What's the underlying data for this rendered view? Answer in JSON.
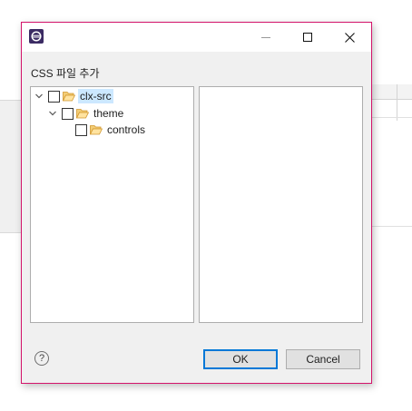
{
  "dialog": {
    "title": "CSS 파일 추가",
    "window_controls": {
      "minimize": "minimize-icon",
      "maximize": "maximize-icon",
      "close": "close-icon"
    },
    "app_icon": "eclipse-icon"
  },
  "tree": {
    "items": [
      {
        "label": "clx-src",
        "expanded": true,
        "checked": false,
        "selected": true
      },
      {
        "label": "theme",
        "expanded": true,
        "checked": false,
        "selected": false
      },
      {
        "label": "controls",
        "expanded": false,
        "checked": false,
        "selected": false
      }
    ]
  },
  "buttons": {
    "help": "?",
    "ok": "OK",
    "cancel": "Cancel"
  },
  "colors": {
    "accent": "#0078d7",
    "border_focus": "#d3136a",
    "selection": "#cce8ff",
    "folder": "#e8a33a"
  }
}
